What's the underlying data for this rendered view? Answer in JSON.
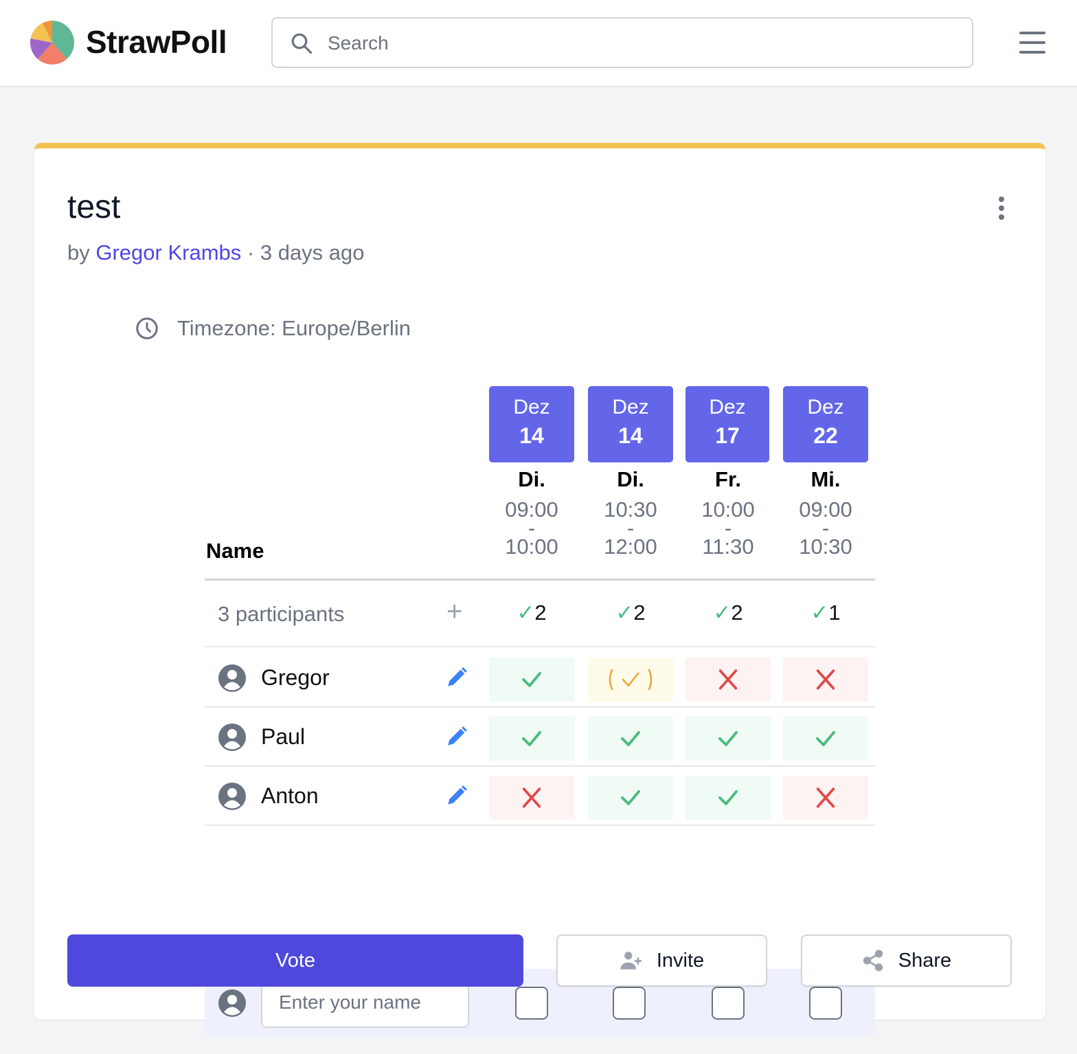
{
  "header": {
    "brand": "StrawPoll",
    "logo_colors": [
      "#60b795",
      "#f17f6a",
      "#9d67c9",
      "#f4c155",
      "#f09438"
    ],
    "search_placeholder": "Search"
  },
  "poll": {
    "title": "test",
    "by_prefix": "by",
    "author": "Gregor Krambs",
    "separator": " · ",
    "age": "3 days ago",
    "timezone": "Timezone: Europe/Berlin",
    "accent_color": "#f2c14e"
  },
  "table": {
    "name_header": "Name",
    "participants_label": "3 participants",
    "add_symbol": "+",
    "options": [
      {
        "month": "Dez",
        "day": "14",
        "weekday": "Di.",
        "start": "09:00",
        "dash": "-",
        "end": "10:00",
        "yes_count": "2"
      },
      {
        "month": "Dez",
        "day": "14",
        "weekday": "Di.",
        "start": "10:30",
        "dash": "-",
        "end": "12:00",
        "yes_count": "2"
      },
      {
        "month": "Dez",
        "day": "17",
        "weekday": "Fr.",
        "start": "10:00",
        "dash": "-",
        "end": "11:30",
        "yes_count": "2"
      },
      {
        "month": "Dez",
        "day": "22",
        "weekday": "Mi.",
        "start": "09:00",
        "dash": "-",
        "end": "10:30",
        "yes_count": "1"
      }
    ],
    "participants": [
      {
        "name": "Gregor",
        "votes": [
          "yes",
          "ifneedbe",
          "no",
          "no"
        ]
      },
      {
        "name": "Paul",
        "votes": [
          "yes",
          "yes",
          "yes",
          "yes"
        ]
      },
      {
        "name": "Anton",
        "votes": [
          "no",
          "yes",
          "yes",
          "no"
        ]
      }
    ],
    "new_participant_placeholder": "Enter your name"
  },
  "actions": {
    "vote": "Vote",
    "invite": "Invite",
    "share": "Share"
  },
  "colors": {
    "yes": "#4dbb7f",
    "ifneedbe": "#f0a43a",
    "no": "#e04848",
    "primary": "#4f48dd",
    "date_box": "#6366e9"
  }
}
